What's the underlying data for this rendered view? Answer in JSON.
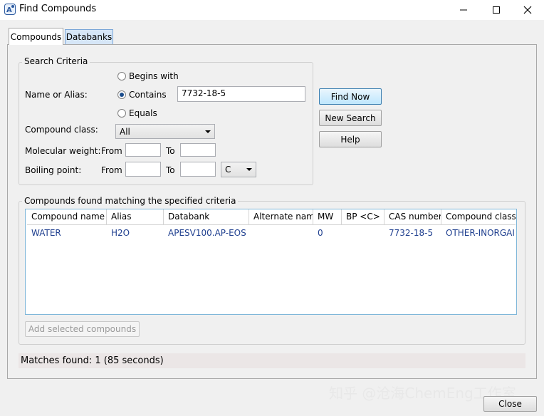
{
  "window": {
    "title": "Find Compounds",
    "icons": {
      "app": "app-icon",
      "minimize": "minimize-icon",
      "maximize": "maximize-icon",
      "close": "close-icon"
    }
  },
  "tabs": [
    {
      "label": "Compounds",
      "active": true
    },
    {
      "label": "Databanks",
      "active": false
    }
  ],
  "search": {
    "group_label": "Search Criteria",
    "name_label": "Name or Alias:",
    "radio_options": [
      "Begins with",
      "Contains",
      "Equals"
    ],
    "selected_radio": "Contains",
    "name_value": "7732-18-5",
    "compound_class_label": "Compound class:",
    "compound_class_value": "All",
    "mw_label": "Molecular weight:",
    "bp_label": "Boiling point:",
    "from_label": "From",
    "to_label": "To",
    "mw_from": "",
    "mw_to": "",
    "bp_from": "",
    "bp_to": "",
    "bp_unit": "C"
  },
  "buttons": {
    "find_now": "Find Now",
    "new_search": "New Search",
    "help": "Help",
    "add_selected": "Add selected compounds",
    "close": "Close"
  },
  "results": {
    "group_label": "Compounds found matching the specified criteria",
    "columns": [
      "Compound name",
      "Alias",
      "Databank",
      "Alternate name",
      "MW",
      "BP <C>",
      "CAS number",
      "Compound class"
    ],
    "rows": [
      [
        "WATER",
        "H2O",
        "APESV100.AP-EOS",
        "",
        "0",
        "",
        "7732-18-5",
        "OTHER-INORGAI"
      ]
    ]
  },
  "status": "Matches found: 1 (85 seconds)",
  "watermark": "知乎 @沧海ChemEng工作室",
  "colors": {
    "accent": "#3c7fb1",
    "link_text": "#1f3f8f",
    "tab_inactive": "#d6e6f7"
  }
}
